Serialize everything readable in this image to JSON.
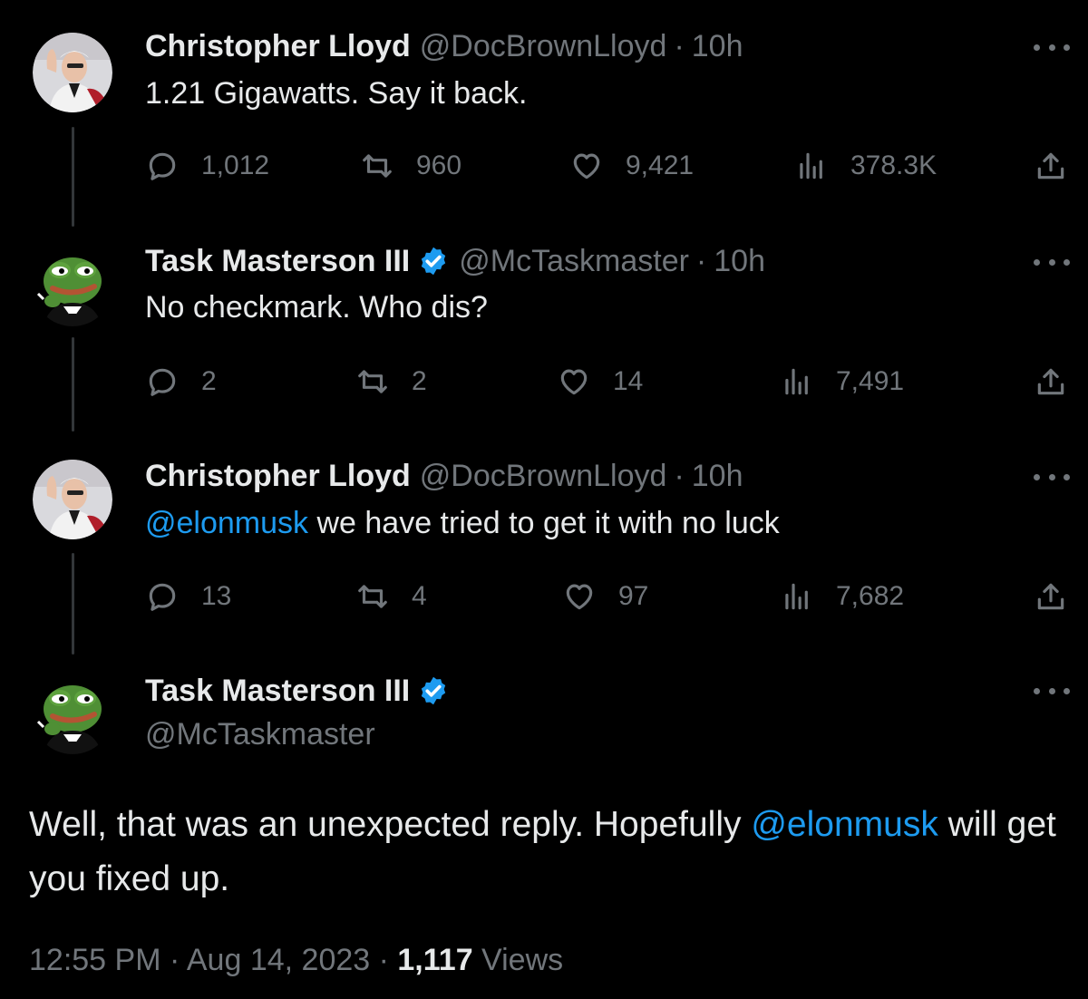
{
  "tweets": [
    {
      "name": "Christopher Lloyd",
      "handle": "@DocBrownLloyd",
      "separator": "·",
      "time": "10h",
      "text": "1.21 Gigawatts. Say it back.",
      "replies": "1,012",
      "retweets": "960",
      "likes": "9,421",
      "views": "378.3K"
    },
    {
      "name": "Task Masterson III",
      "handle": "@McTaskmaster",
      "separator": "·",
      "time": "10h",
      "text": "No checkmark. Who dis?",
      "replies": "2",
      "retweets": "2",
      "likes": "14",
      "views": "7,491"
    },
    {
      "name": "Christopher Lloyd",
      "handle": "@DocBrownLloyd",
      "separator": "·",
      "time": "10h",
      "mention": "@elonmusk",
      "text": " we have tried to get it with no luck",
      "replies": "13",
      "retweets": "4",
      "likes": "97",
      "views": "7,682"
    }
  ],
  "main_tweet": {
    "name": "Task Masterson III",
    "handle": "@McTaskmaster",
    "text_before": "Well, that was an unexpected reply. Hopefully ",
    "mention": "@elonmusk",
    "text_after": " will get you fixed up.",
    "time": "12:55 PM",
    "separator1": " · ",
    "date": "Aug 14, 2023",
    "separator2": " · ",
    "views_count": "1,117",
    "views_label": " Views"
  },
  "colors": {
    "background": "#000000",
    "text": "#e7e9ea",
    "muted": "#71767b",
    "accent": "#1d9bf0"
  },
  "icons": {
    "verified": "verified-badge-icon",
    "reply": "reply-icon",
    "retweet": "retweet-icon",
    "like": "heart-icon",
    "views": "views-icon",
    "share": "share-icon",
    "more": "more-icon"
  }
}
